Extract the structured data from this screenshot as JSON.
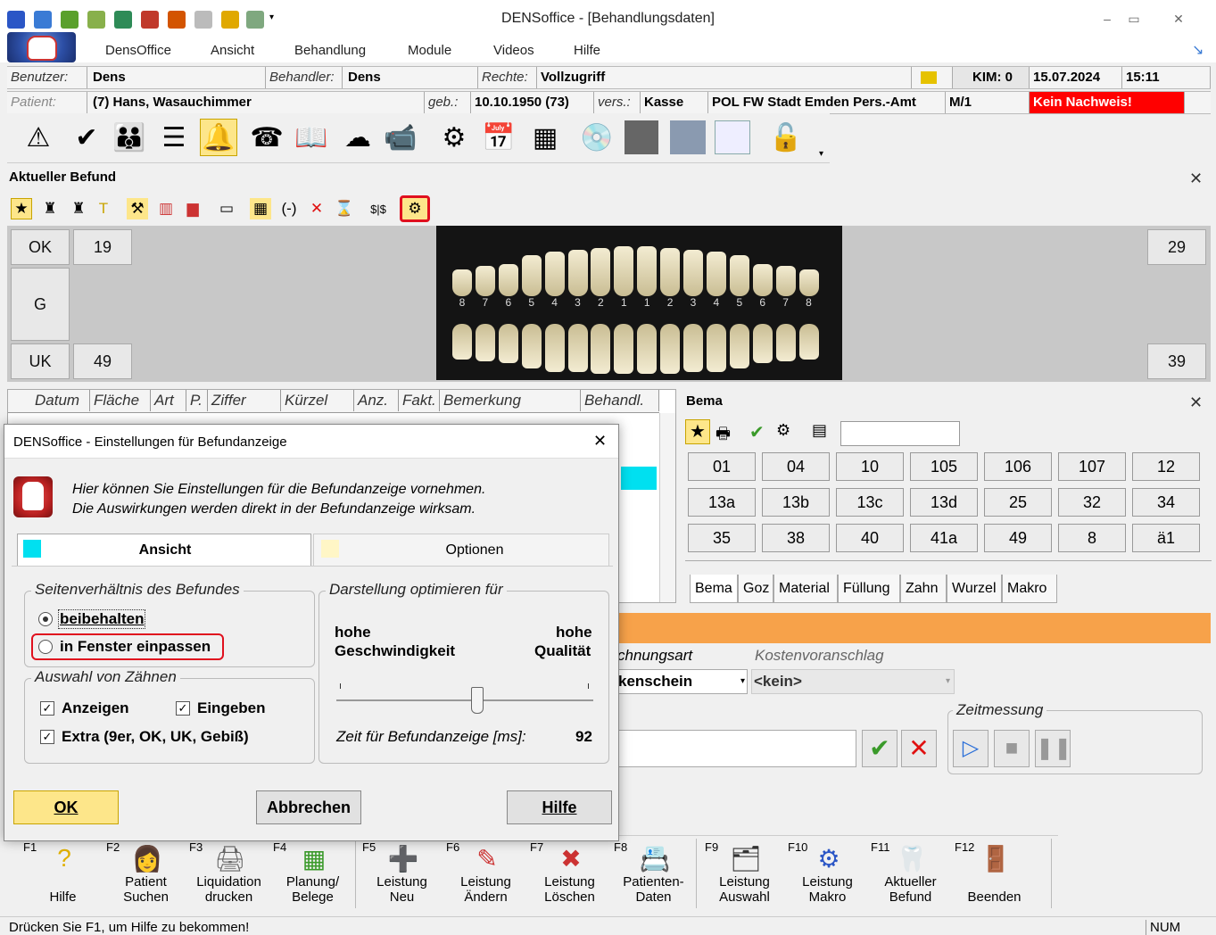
{
  "window": {
    "title": "DENSoffice -  [Behandlungsdaten]",
    "minimize": "–",
    "restore": "▭",
    "close": "✕"
  },
  "menu": [
    "DensOffice",
    "Ansicht",
    "Behandlung",
    "Module",
    "Videos",
    "Hilfe"
  ],
  "info": {
    "benutzer_label": "Benutzer:",
    "benutzer": "Dens",
    "behandler_label": "Behandler:",
    "behandler": "Dens",
    "rechte_label": "Rechte:",
    "rechte": "Vollzugriff",
    "kim": "KIM: 0",
    "date": "15.07.2024",
    "time": "15:11",
    "patient_label": "Patient:",
    "patient": "(7) Hans, Wasauchimmer",
    "geb_label": "geb.:",
    "geb": "10.10.1950 (73)",
    "vers_label": "vers.:",
    "vers": "Kasse",
    "kasse": "POL FW Stadt  Emden Pers.-Amt",
    "mstatus": "M/1",
    "nachweis": "Kein Nachweis!"
  },
  "befund": {
    "title": "Aktueller Befund",
    "ok": "OK",
    "g": "G",
    "uk": "UK",
    "n19": "19",
    "n49": "49",
    "n29": "29",
    "n39": "39",
    "teeth_numbers": [
      "8",
      "7",
      "6",
      "5",
      "4",
      "3",
      "2",
      "1",
      "1",
      "2",
      "3",
      "4",
      "5",
      "6",
      "7",
      "8"
    ]
  },
  "table": {
    "headers": [
      "Datum",
      "Fläche",
      "Art",
      "P.",
      "Ziffer",
      "Kürzel",
      "Anz.",
      "Fakt.",
      "Bemerkung",
      "Behandl."
    ]
  },
  "bema": {
    "title": "Bema",
    "codes": [
      "01",
      "04",
      "10",
      "105",
      "106",
      "107",
      "12",
      "13a",
      "13b",
      "13c",
      "13d",
      "25",
      "32",
      "34",
      "35",
      "38",
      "40",
      "41a",
      "49",
      "8",
      "ä1"
    ],
    "tabs": [
      "Bema",
      "Goz",
      "Material",
      "Füllung",
      "Zahn",
      "Wurzel",
      "Makro"
    ]
  },
  "form": {
    "rechnungsart_label": "chnungsart",
    "kostenvoranschlag_label": "Kostenvoranschlag",
    "rechnungsart_value": "kenschein",
    "kostenvoranschlag_value": "<kein>",
    "zeitmessung_label": "Zeitmessung"
  },
  "dialog": {
    "title": "DENSoffice - Einstellungen für Befundanzeige",
    "info_line1": "Hier können Sie Einstellungen für die Befundanzeige vornehmen.",
    "info_line2": "Die Auswirkungen werden direkt in der Befundanzeige wirksam.",
    "tab_ansicht": "Ansicht",
    "tab_optionen": "Optionen",
    "group_seitenverhaeltnis": "Seitenverhältnis des Befundes",
    "radio_beibehalten": "beibehalten",
    "radio_einpassen": "in Fenster einpassen",
    "group_auswahl": "Auswahl von Zähnen",
    "chk_anzeigen": "Anzeigen",
    "chk_eingeben": "Eingeben",
    "chk_extra": "Extra (9er, OK, UK, Gebiß)",
    "group_darstellung": "Darstellung optimieren für",
    "left_label_1": "hohe",
    "left_label_2": "Geschwindigkeit",
    "right_label_1": "hohe",
    "right_label_2": "Qualität",
    "slider_value": 0.55,
    "zeit_label": "Zeit für Befundanzeige [ms]:",
    "zeit_value": "92",
    "btn_ok": "OK",
    "btn_abbrechen": "Abbrechen",
    "btn_hilfe": "Hilfe",
    "close": "✕"
  },
  "fkeys": [
    {
      "key": "F1",
      "line1": "",
      "line2": "Hilfe"
    },
    {
      "key": "F2",
      "line1": "Patient",
      "line2": "Suchen"
    },
    {
      "key": "F3",
      "line1": "Liquidation",
      "line2": "drucken"
    },
    {
      "key": "F4",
      "line1": "Planung/",
      "line2": "Belege"
    },
    {
      "key": "F5",
      "line1": "Leistung",
      "line2": "Neu"
    },
    {
      "key": "F6",
      "line1": "Leistung",
      "line2": "Ändern"
    },
    {
      "key": "F7",
      "line1": "Leistung",
      "line2": "Löschen"
    },
    {
      "key": "F8",
      "line1": "Patienten-",
      "line2": "Daten"
    },
    {
      "key": "F9",
      "line1": "Leistung",
      "line2": "Auswahl"
    },
    {
      "key": "F10",
      "line1": "Leistung",
      "line2": "Makro"
    },
    {
      "key": "F11",
      "line1": "Aktueller",
      "line2": "Befund"
    },
    {
      "key": "F12",
      "line1": "",
      "line2": "Beenden"
    }
  ],
  "status": {
    "text": "Drücken Sie F1, um Hilfe zu bekommen!",
    "num": "NUM"
  },
  "colors": {
    "highlight_red": "#e0101e",
    "nachweis_bg": "#ff0000",
    "orange_bar": "#f7a24a",
    "cyan": "#00e0f0",
    "ok_btn": "#fde68a"
  }
}
